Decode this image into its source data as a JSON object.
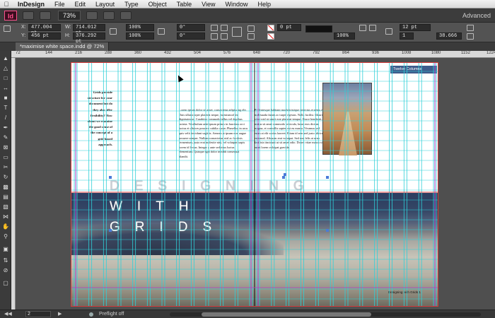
{
  "menubar": {
    "apple": "",
    "items": [
      "InDesign",
      "File",
      "Edit",
      "Layout",
      "Type",
      "Object",
      "Table",
      "View",
      "Window",
      "Help"
    ]
  },
  "appbar": {
    "logo": "Id",
    "zoom": "73%",
    "workspace": "Advanced"
  },
  "control": {
    "x_label": "X:",
    "x_value": "477.004 pt",
    "y_label": "Y:",
    "y_value": "456 pt",
    "w_label": "W:",
    "w_value": "714.012 pt",
    "h_label": "H:",
    "h_value": "376.292 pt",
    "scale_x": "100%",
    "scale_y": "100%",
    "angle": "0°",
    "shear": "0°",
    "stroke_weight": "0 pt",
    "opacity": "100%",
    "col_width": "12 pt",
    "count": "1",
    "gutter": "38.666"
  },
  "tab": {
    "title": "*maximise white space.indd @ 72%"
  },
  "ruler": {
    "ticks": [
      "72",
      "144",
      "216",
      "288",
      "360",
      "432",
      "504",
      "576",
      "648",
      "720",
      "792",
      "864",
      "936",
      "1008",
      "1080",
      "1152",
      "1224"
    ]
  },
  "document": {
    "side_note": "Grids provide structure for your document but do they also offer flexibility? How about we examine the good sense of the concept of a grid based approach.",
    "body_col1": "Lorem ipsum dolor sit amet, consectetur adipiscing elit. Duis ullamcorper placerat neque, eu euismod leo dignissim ac. Curabitur commodo tellus vel dapibus lacinia. Vestibulum ante ipsum primis in faucibus orci luctus et ultrices posuere cubilia curae; Phasellus in arcu quis velit tincidunt sagittis. Aenean at ipsum non augue posuere semper. Nullam consectetur, nisl ac facilisis fermentum, justo erat molestie nisi, vel volutpat turpis lorem id lectus. Integer a ante sed risus luctus elementum. Quisque eget dolor in nibh consequat blandit.",
    "body_col2": "Pellentesque habitant morbi tristique senectus et netus et malesuada fames ac turpis egestas. Nulla facilisi. Mauris vitae nisl sit amet erat placerat tempus. Fusce hendrerit, metus sit amet commodo vehicula, lacus eros dictum magna, et convallis sapien est eu massa. Vivamus sed enim at elit varius laoreet. Etiam id sem sed justo ultrices euismod. Aliquam erat volutpat. Sed non felis at urna facilisis tincidunt ut sit amet odio. Donec vitae massa sit amet lorem volutpat gravida.",
    "heading_line1": "DESIGNING",
    "heading_line2": "WITH",
    "heading_line3": "GRIDS",
    "label_box": "Twelve Columns",
    "footer": "Designing with Grids   1"
  },
  "status": {
    "page": "2",
    "preflight": "Preflight off"
  },
  "colors": {
    "accent": "#ff4f8c",
    "guide_cyan": "#2fd0d8",
    "guide_magenta": "#b140c8",
    "bleed": "#d23a3a",
    "label": "#3e5c8c"
  }
}
